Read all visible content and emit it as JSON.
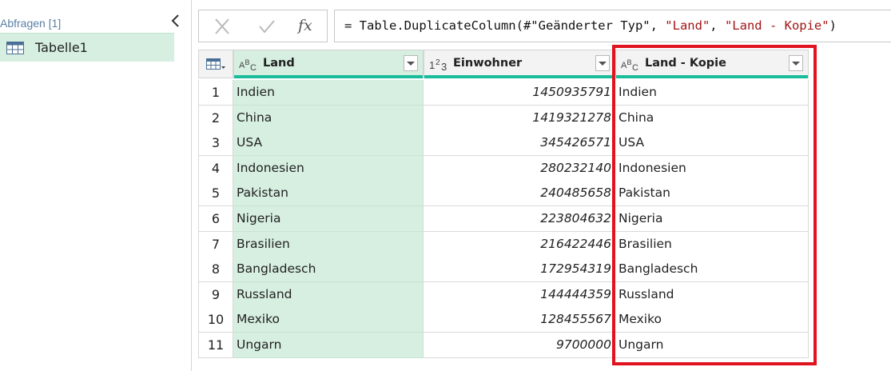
{
  "queries": {
    "header": "Abfragen [1]",
    "items": [
      {
        "label": "Tabelle1",
        "icon": "table-icon"
      }
    ]
  },
  "formula_bar": {
    "cancel_icon": "cancel-x-icon",
    "accept_icon": "checkmark-icon",
    "fx_label": "fx",
    "tokens": [
      {
        "text": "= Table.DuplicateColumn(#\"Geänderter Typ\", ",
        "kind": "plain"
      },
      {
        "text": "\"Land\"",
        "kind": "str"
      },
      {
        "text": ", ",
        "kind": "plain"
      },
      {
        "text": "\"Land - Kopie\"",
        "kind": "str"
      },
      {
        "text": ")",
        "kind": "plain"
      }
    ]
  },
  "table": {
    "columns": [
      {
        "name": "Land",
        "type": "text",
        "type_icon": "ABC"
      },
      {
        "name": "Einwohner",
        "type": "number",
        "type_icon": "123"
      },
      {
        "name": "Land - Kopie",
        "type": "text",
        "type_icon": "ABC"
      }
    ],
    "rows": [
      {
        "n": "1",
        "land": "Indien",
        "einwohner": "1450935791",
        "kopie": "Indien"
      },
      {
        "n": "2",
        "land": "China",
        "einwohner": "1419321278",
        "kopie": "China"
      },
      {
        "n": "3",
        "land": "USA",
        "einwohner": "345426571",
        "kopie": "USA"
      },
      {
        "n": "4",
        "land": "Indonesien",
        "einwohner": "280232140",
        "kopie": "Indonesien"
      },
      {
        "n": "5",
        "land": "Pakistan",
        "einwohner": "240485658",
        "kopie": "Pakistan"
      },
      {
        "n": "6",
        "land": "Nigeria",
        "einwohner": "223804632",
        "kopie": "Nigeria"
      },
      {
        "n": "7",
        "land": "Brasilien",
        "einwohner": "216422446",
        "kopie": "Brasilien"
      },
      {
        "n": "8",
        "land": "Bangladesch",
        "einwohner": "172954319",
        "kopie": "Bangladesch"
      },
      {
        "n": "9",
        "land": "Russland",
        "einwohner": "144444359",
        "kopie": "Russland"
      },
      {
        "n": "10",
        "land": "Mexiko",
        "einwohner": "128455567",
        "kopie": "Mexiko"
      },
      {
        "n": "11",
        "land": "Ungarn",
        "einwohner": "9700000",
        "kopie": "Ungarn"
      }
    ]
  },
  "colors": {
    "selected_column": "#d6efe0",
    "header_bar": "#1abc9c",
    "highlight": "#e0141e",
    "string_literal": "#a31515"
  }
}
